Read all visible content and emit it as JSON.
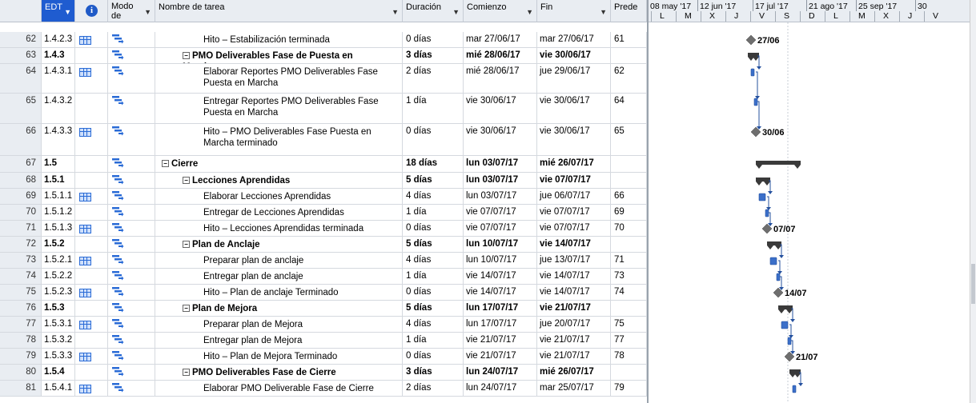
{
  "columns": {
    "edt": "EDT",
    "mode": "Modo de",
    "task": "Nombre de tarea",
    "duration": "Duración",
    "start": "Comienzo",
    "finish": "Fin",
    "pred": "Prede"
  },
  "timescale": {
    "major": [
      "08 may '17",
      "12 jun '17",
      "17 jul '17",
      "21 ago '17",
      "25 sep '17",
      "30"
    ],
    "minor": [
      "L",
      "M",
      "X",
      "J",
      "V",
      "S",
      "D",
      "L",
      "M",
      "X",
      "J",
      "V"
    ]
  },
  "colors": {
    "header_selected": "#1f5cd0",
    "bar": "#3b6fc9",
    "summary": "#3a3a3a",
    "milestone": "#6e6e6e"
  },
  "rows": [
    {
      "id": "62",
      "edt": "1.4.2.3",
      "note": true,
      "level": 3,
      "summary": false,
      "name": "Hito – Estabilización terminada",
      "duration": "0 días",
      "start": "mar 27/06/17",
      "finish": "mar 27/06/17",
      "pred": "61"
    },
    {
      "id": "63",
      "edt": "1.4.3",
      "note": false,
      "level": 2,
      "summary": true,
      "name": "PMO Deliverables Fase de Puesta en Marcha",
      "duration": "3 días",
      "start": "mié 28/06/17",
      "finish": "vie 30/06/17",
      "pred": ""
    },
    {
      "id": "64",
      "edt": "1.4.3.1",
      "note": true,
      "level": 3,
      "summary": false,
      "name": "Elaborar Reportes PMO Deliverables Fase Puesta en Marcha",
      "duration": "2 días",
      "start": "mié 28/06/17",
      "finish": "jue 29/06/17",
      "pred": "62"
    },
    {
      "id": "65",
      "edt": "1.4.3.2",
      "note": false,
      "level": 3,
      "summary": false,
      "name": "Entregar  Reportes PMO Deliverables Fase Puesta en Marcha",
      "duration": "1 día",
      "start": "vie 30/06/17",
      "finish": "vie 30/06/17",
      "pred": "64"
    },
    {
      "id": "66",
      "edt": "1.4.3.3",
      "note": true,
      "level": 3,
      "summary": false,
      "name": "Hito – PMO Deliverables Fase Puesta en Marcha terminado",
      "duration": "0 días",
      "start": "vie 30/06/17",
      "finish": "vie 30/06/17",
      "pred": "65"
    },
    {
      "id": "67",
      "edt": "1.5",
      "note": false,
      "level": 1,
      "summary": true,
      "name": "Cierre",
      "duration": "18 días",
      "start": "lun 03/07/17",
      "finish": "mié 26/07/17",
      "pred": ""
    },
    {
      "id": "68",
      "edt": "1.5.1",
      "note": false,
      "level": 2,
      "summary": true,
      "name": "Lecciones Aprendidas",
      "duration": "5 días",
      "start": "lun 03/07/17",
      "finish": "vie 07/07/17",
      "pred": ""
    },
    {
      "id": "69",
      "edt": "1.5.1.1",
      "note": true,
      "level": 3,
      "summary": false,
      "name": "Elaborar  Lecciones Aprendidas",
      "duration": "4 días",
      "start": "lun 03/07/17",
      "finish": "jue 06/07/17",
      "pred": "66"
    },
    {
      "id": "70",
      "edt": "1.5.1.2",
      "note": false,
      "level": 3,
      "summary": false,
      "name": "Entregar de Lecciones Aprendidas",
      "duration": "1 día",
      "start": "vie 07/07/17",
      "finish": "vie 07/07/17",
      "pred": "69"
    },
    {
      "id": "71",
      "edt": "1.5.1.3",
      "note": true,
      "level": 3,
      "summary": false,
      "name": "Hito – Lecciones Aprendidas terminada",
      "duration": "0 días",
      "start": "vie 07/07/17",
      "finish": "vie 07/07/17",
      "pred": "70"
    },
    {
      "id": "72",
      "edt": "1.5.2",
      "note": false,
      "level": 2,
      "summary": true,
      "name": "Plan de Anclaje",
      "duration": "5 días",
      "start": "lun 10/07/17",
      "finish": "vie 14/07/17",
      "pred": ""
    },
    {
      "id": "73",
      "edt": "1.5.2.1",
      "note": true,
      "level": 3,
      "summary": false,
      "name": "Preparar plan de anclaje",
      "duration": "4 días",
      "start": "lun 10/07/17",
      "finish": "jue 13/07/17",
      "pred": "71"
    },
    {
      "id": "74",
      "edt": "1.5.2.2",
      "note": false,
      "level": 3,
      "summary": false,
      "name": "Entregar plan de anclaje",
      "duration": "1 día",
      "start": "vie 14/07/17",
      "finish": "vie 14/07/17",
      "pred": "73"
    },
    {
      "id": "75",
      "edt": "1.5.2.3",
      "note": true,
      "level": 3,
      "summary": false,
      "name": "Hito – Plan de anclaje Terminado",
      "duration": "0 días",
      "start": "vie 14/07/17",
      "finish": "vie 14/07/17",
      "pred": "74"
    },
    {
      "id": "76",
      "edt": "1.5.3",
      "note": false,
      "level": 2,
      "summary": true,
      "name": "Plan de Mejora",
      "duration": "5 días",
      "start": "lun 17/07/17",
      "finish": "vie 21/07/17",
      "pred": ""
    },
    {
      "id": "77",
      "edt": "1.5.3.1",
      "note": true,
      "level": 3,
      "summary": false,
      "name": "Preparar plan de Mejora",
      "duration": "4 días",
      "start": "lun 17/07/17",
      "finish": "jue 20/07/17",
      "pred": "75"
    },
    {
      "id": "78",
      "edt": "1.5.3.2",
      "note": false,
      "level": 3,
      "summary": false,
      "name": "Entregar plan de Mejora",
      "duration": "1 día",
      "start": "vie 21/07/17",
      "finish": "vie 21/07/17",
      "pred": "77"
    },
    {
      "id": "79",
      "edt": "1.5.3.3",
      "note": true,
      "level": 3,
      "summary": false,
      "name": "Hito – Plan de Mejora Terminado",
      "duration": "0 días",
      "start": "vie 21/07/17",
      "finish": "vie 21/07/17",
      "pred": "78"
    },
    {
      "id": "80",
      "edt": "1.5.4",
      "note": false,
      "level": 2,
      "summary": true,
      "name": "PMO Deliverables Fase de Cierre",
      "duration": "3 días",
      "start": "lun 24/07/17",
      "finish": "mié 26/07/17",
      "pred": ""
    },
    {
      "id": "81",
      "edt": "1.5.4.1",
      "note": true,
      "level": 3,
      "summary": false,
      "name": "Elaborar PMO Deliverable Fase de Cierre",
      "duration": "2 días",
      "start": "lun 24/07/17",
      "finish": "mar 25/07/17",
      "pred": "79"
    }
  ],
  "milestone_labels": [
    "27/06",
    "30/06",
    "07/07",
    "14/07",
    "21/07"
  ]
}
